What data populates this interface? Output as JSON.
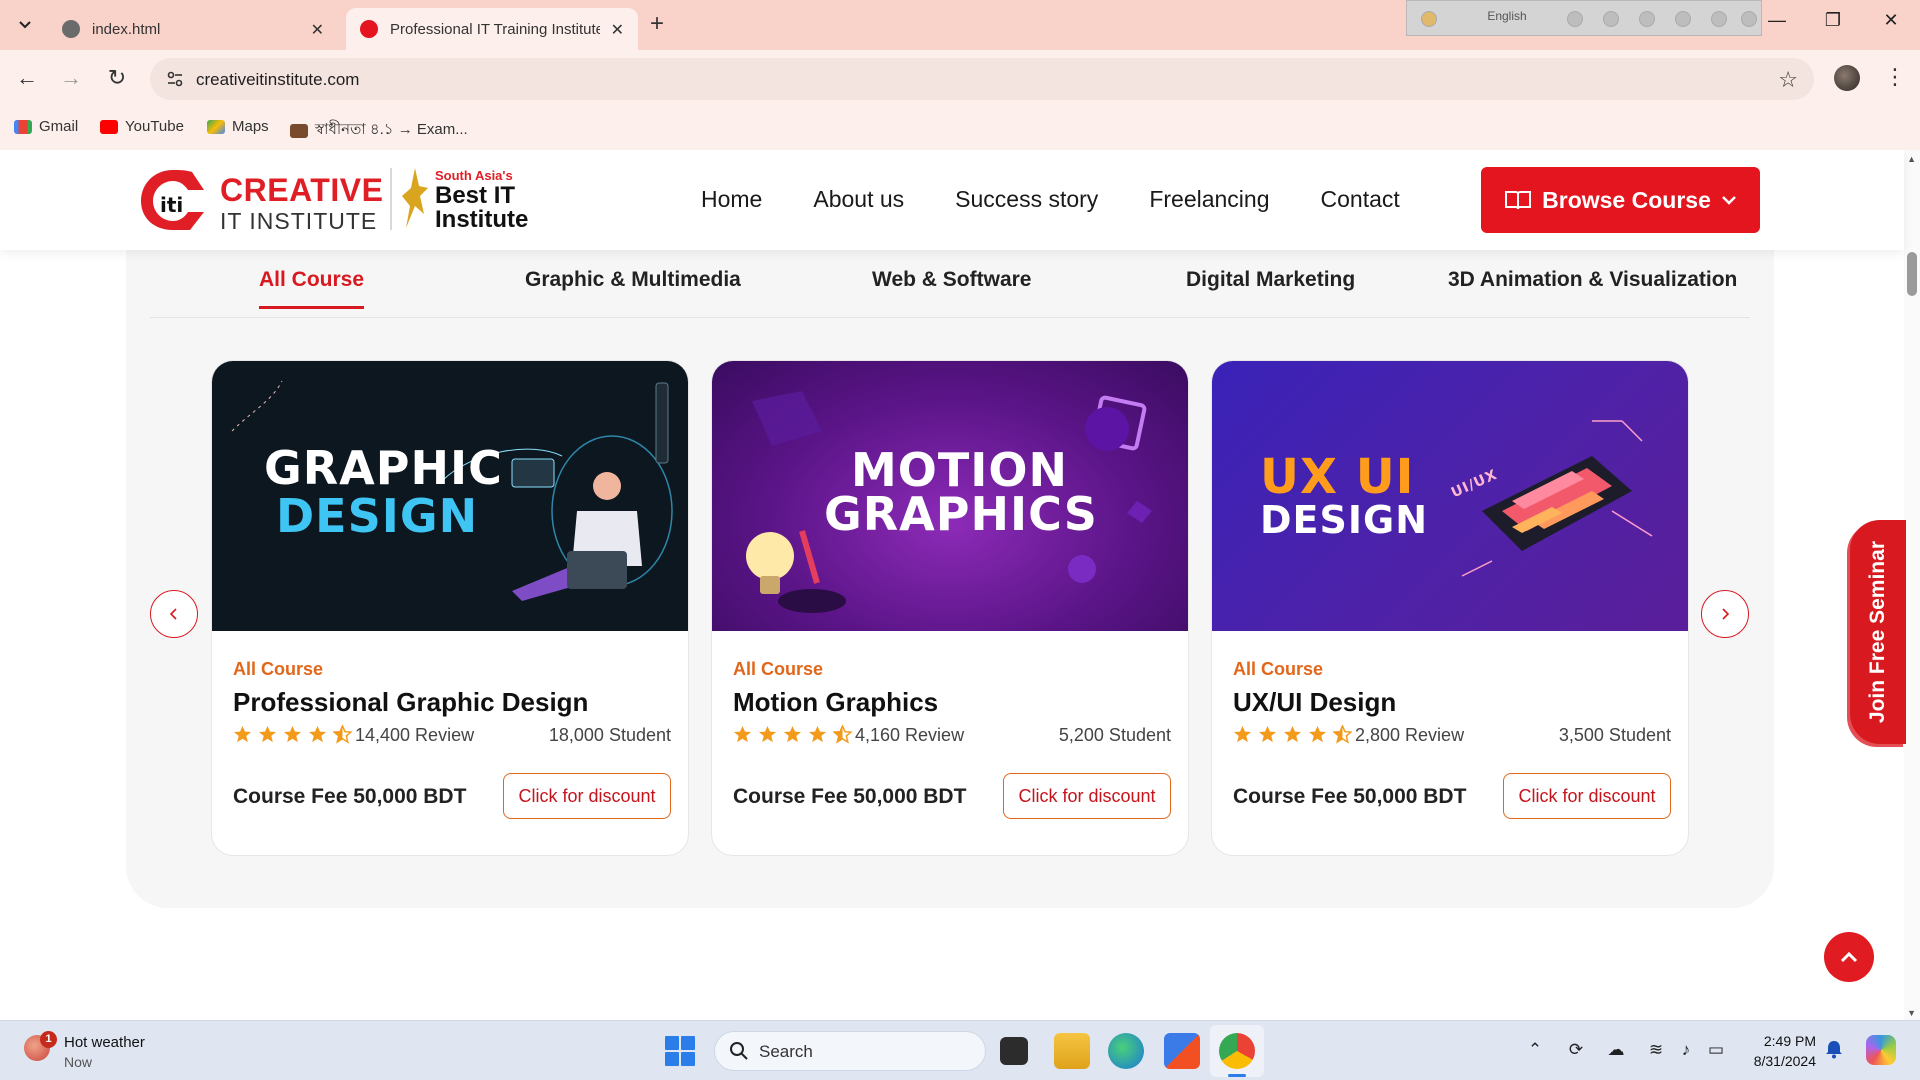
{
  "browser": {
    "tabs": [
      {
        "title": "index.html",
        "active": false
      },
      {
        "title": "Professional IT Training Institute",
        "active": true
      }
    ],
    "url": "creativeitinstitute.com",
    "ime_language": "English",
    "bookmarks": [
      "Gmail",
      "YouTube",
      "Maps",
      "স্বাধীনতা ৪.১ → Exam..."
    ]
  },
  "header": {
    "logo": {
      "brand_line1": "CREATIVE",
      "brand_line2": "IT INSTITUTE",
      "tag_line1": "South Asia's",
      "tag_line2": "Best IT",
      "tag_line3": "Institute"
    },
    "nav": [
      "Home",
      "About us",
      "Success story",
      "Freelancing",
      "Contact"
    ],
    "browse_label": "Browse Course"
  },
  "categories": [
    "All Course",
    "Graphic & Multimedia",
    "Web & Software",
    "Digital Marketing",
    "3D Animation & Visualization"
  ],
  "cards": [
    {
      "image_text": [
        "GRAPHIC",
        "DESIGN"
      ],
      "category": "All Course",
      "title": "Professional Graphic Design",
      "rating": 4.5,
      "reviews": "14,400 Review",
      "students": "18,000 Student",
      "fee": "Course Fee 50,000 BDT",
      "cta": "Click for discount"
    },
    {
      "image_text": [
        "MOTION",
        "GRAPHICS"
      ],
      "category": "All Course",
      "title": "Motion Graphics",
      "rating": 4.5,
      "reviews": "4,160 Review",
      "students": "5,200 Student",
      "fee": "Course Fee 50,000 BDT",
      "cta": "Click for discount"
    },
    {
      "image_text": [
        "UX UI",
        "DESIGN"
      ],
      "image_sub": "UI/UX",
      "category": "All Course",
      "title": "UX/UI Design",
      "rating": 4.5,
      "reviews": "2,800 Review",
      "students": "3,500 Student",
      "fee": "Course Fee 50,000 BDT",
      "cta": "Click for discount"
    }
  ],
  "seminar_label": "Join Free Seminar",
  "taskbar": {
    "weather_title": "Hot weather",
    "weather_time": "Now",
    "weather_badge": "1",
    "search_label": "Search",
    "time": "2:49 PM",
    "date": "8/31/2024"
  },
  "colors": {
    "brand_red": "#e4151f",
    "accent_orange": "#e1671b",
    "tab_bar": "#f9d3c9"
  }
}
